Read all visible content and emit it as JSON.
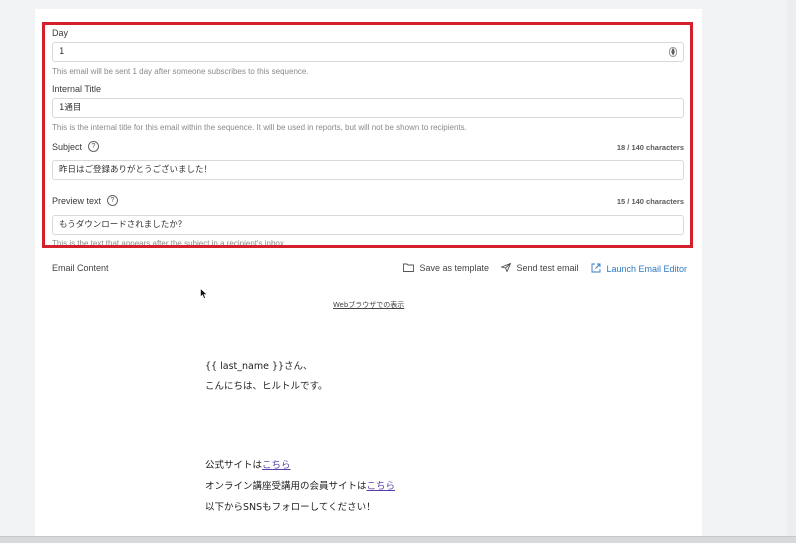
{
  "form": {
    "day": {
      "label": "Day",
      "value": "1",
      "help": "This email will be sent 1 day after someone subscribes to this sequence."
    },
    "internal_title": {
      "label": "Internal Title",
      "value": "1通目",
      "help": "This is the internal title for this email within the sequence. It will be used in reports, but will not be shown to recipients."
    },
    "subject": {
      "label": "Subject",
      "value": "昨日はご登録ありがとうございました！",
      "count": "18 / 140 characters"
    },
    "preview_text": {
      "label": "Preview text",
      "value": "もうダウンロードされましたか？",
      "count": "15 / 140 characters",
      "help": "This is the text that appears after the subject in a recipient's inbox."
    }
  },
  "email_content": {
    "label": "Email Content",
    "save_template": "Save as template",
    "send_test": "Send test email",
    "launch_editor": "Launch Email Editor",
    "web_browser_link": "Webブラウザでの表示",
    "body": {
      "greeting": "{{ last_name }}さん、",
      "intro": "こんにちは、ヒルトルです。",
      "official_site_prefix": "公式サイトは",
      "official_site_link": "こちら",
      "member_site_prefix": "オンライン講座受講用の会員サイトは",
      "member_site_link": "こちら",
      "sns": " 以下からSNSもフォローしてください！"
    }
  },
  "colors": {
    "highlight_border": "#d2212b",
    "link_blue": "#2f79c2",
    "body_link": "#5a3ea8"
  },
  "icons": [
    "question-circle-icon",
    "folder-icon",
    "send-icon",
    "external-link-icon",
    "spinner-icon",
    "mouse-cursor-icon"
  ]
}
